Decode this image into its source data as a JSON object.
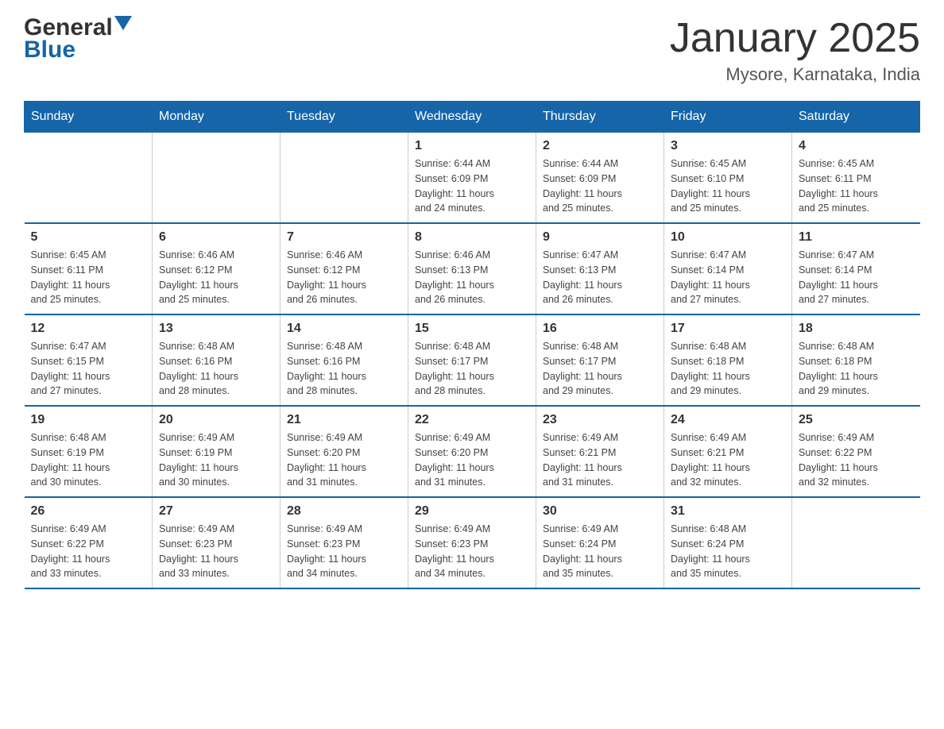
{
  "header": {
    "logo": {
      "line1": "General",
      "line2": "Blue"
    },
    "title": "January 2025",
    "location": "Mysore, Karnataka, India"
  },
  "days_of_week": [
    "Sunday",
    "Monday",
    "Tuesday",
    "Wednesday",
    "Thursday",
    "Friday",
    "Saturday"
  ],
  "weeks": [
    [
      {
        "day": "",
        "info": ""
      },
      {
        "day": "",
        "info": ""
      },
      {
        "day": "",
        "info": ""
      },
      {
        "day": "1",
        "info": "Sunrise: 6:44 AM\nSunset: 6:09 PM\nDaylight: 11 hours\nand 24 minutes."
      },
      {
        "day": "2",
        "info": "Sunrise: 6:44 AM\nSunset: 6:09 PM\nDaylight: 11 hours\nand 25 minutes."
      },
      {
        "day": "3",
        "info": "Sunrise: 6:45 AM\nSunset: 6:10 PM\nDaylight: 11 hours\nand 25 minutes."
      },
      {
        "day": "4",
        "info": "Sunrise: 6:45 AM\nSunset: 6:11 PM\nDaylight: 11 hours\nand 25 minutes."
      }
    ],
    [
      {
        "day": "5",
        "info": "Sunrise: 6:45 AM\nSunset: 6:11 PM\nDaylight: 11 hours\nand 25 minutes."
      },
      {
        "day": "6",
        "info": "Sunrise: 6:46 AM\nSunset: 6:12 PM\nDaylight: 11 hours\nand 25 minutes."
      },
      {
        "day": "7",
        "info": "Sunrise: 6:46 AM\nSunset: 6:12 PM\nDaylight: 11 hours\nand 26 minutes."
      },
      {
        "day": "8",
        "info": "Sunrise: 6:46 AM\nSunset: 6:13 PM\nDaylight: 11 hours\nand 26 minutes."
      },
      {
        "day": "9",
        "info": "Sunrise: 6:47 AM\nSunset: 6:13 PM\nDaylight: 11 hours\nand 26 minutes."
      },
      {
        "day": "10",
        "info": "Sunrise: 6:47 AM\nSunset: 6:14 PM\nDaylight: 11 hours\nand 27 minutes."
      },
      {
        "day": "11",
        "info": "Sunrise: 6:47 AM\nSunset: 6:14 PM\nDaylight: 11 hours\nand 27 minutes."
      }
    ],
    [
      {
        "day": "12",
        "info": "Sunrise: 6:47 AM\nSunset: 6:15 PM\nDaylight: 11 hours\nand 27 minutes."
      },
      {
        "day": "13",
        "info": "Sunrise: 6:48 AM\nSunset: 6:16 PM\nDaylight: 11 hours\nand 28 minutes."
      },
      {
        "day": "14",
        "info": "Sunrise: 6:48 AM\nSunset: 6:16 PM\nDaylight: 11 hours\nand 28 minutes."
      },
      {
        "day": "15",
        "info": "Sunrise: 6:48 AM\nSunset: 6:17 PM\nDaylight: 11 hours\nand 28 minutes."
      },
      {
        "day": "16",
        "info": "Sunrise: 6:48 AM\nSunset: 6:17 PM\nDaylight: 11 hours\nand 29 minutes."
      },
      {
        "day": "17",
        "info": "Sunrise: 6:48 AM\nSunset: 6:18 PM\nDaylight: 11 hours\nand 29 minutes."
      },
      {
        "day": "18",
        "info": "Sunrise: 6:48 AM\nSunset: 6:18 PM\nDaylight: 11 hours\nand 29 minutes."
      }
    ],
    [
      {
        "day": "19",
        "info": "Sunrise: 6:48 AM\nSunset: 6:19 PM\nDaylight: 11 hours\nand 30 minutes."
      },
      {
        "day": "20",
        "info": "Sunrise: 6:49 AM\nSunset: 6:19 PM\nDaylight: 11 hours\nand 30 minutes."
      },
      {
        "day": "21",
        "info": "Sunrise: 6:49 AM\nSunset: 6:20 PM\nDaylight: 11 hours\nand 31 minutes."
      },
      {
        "day": "22",
        "info": "Sunrise: 6:49 AM\nSunset: 6:20 PM\nDaylight: 11 hours\nand 31 minutes."
      },
      {
        "day": "23",
        "info": "Sunrise: 6:49 AM\nSunset: 6:21 PM\nDaylight: 11 hours\nand 31 minutes."
      },
      {
        "day": "24",
        "info": "Sunrise: 6:49 AM\nSunset: 6:21 PM\nDaylight: 11 hours\nand 32 minutes."
      },
      {
        "day": "25",
        "info": "Sunrise: 6:49 AM\nSunset: 6:22 PM\nDaylight: 11 hours\nand 32 minutes."
      }
    ],
    [
      {
        "day": "26",
        "info": "Sunrise: 6:49 AM\nSunset: 6:22 PM\nDaylight: 11 hours\nand 33 minutes."
      },
      {
        "day": "27",
        "info": "Sunrise: 6:49 AM\nSunset: 6:23 PM\nDaylight: 11 hours\nand 33 minutes."
      },
      {
        "day": "28",
        "info": "Sunrise: 6:49 AM\nSunset: 6:23 PM\nDaylight: 11 hours\nand 34 minutes."
      },
      {
        "day": "29",
        "info": "Sunrise: 6:49 AM\nSunset: 6:23 PM\nDaylight: 11 hours\nand 34 minutes."
      },
      {
        "day": "30",
        "info": "Sunrise: 6:49 AM\nSunset: 6:24 PM\nDaylight: 11 hours\nand 35 minutes."
      },
      {
        "day": "31",
        "info": "Sunrise: 6:48 AM\nSunset: 6:24 PM\nDaylight: 11 hours\nand 35 minutes."
      },
      {
        "day": "",
        "info": ""
      }
    ]
  ]
}
